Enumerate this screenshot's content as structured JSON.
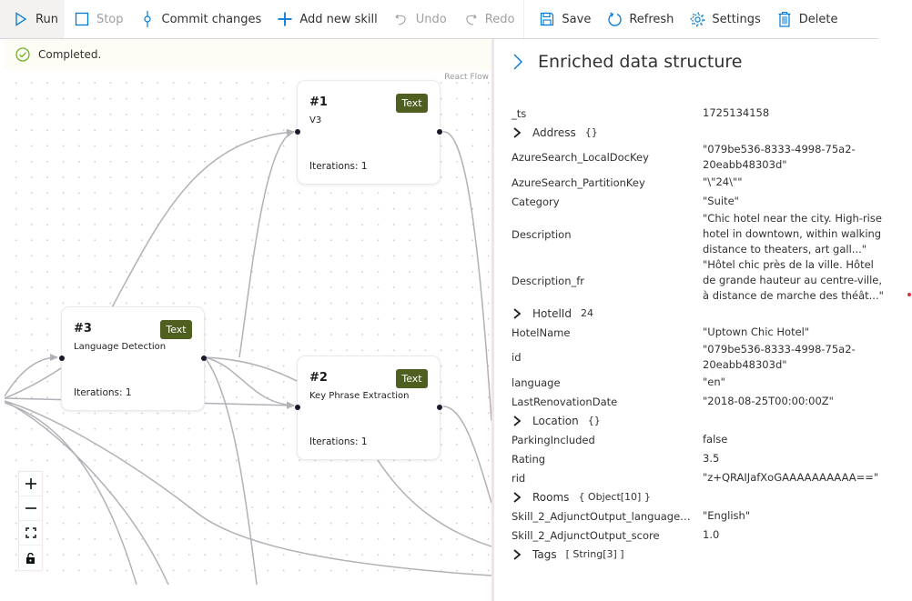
{
  "toolbar": {
    "run": "Run",
    "stop": "Stop",
    "commit": "Commit changes",
    "add_skill": "Add new skill",
    "undo": "Undo",
    "redo": "Redo",
    "save": "Save",
    "refresh": "Refresh",
    "settings": "Settings",
    "delete": "Delete"
  },
  "status": {
    "text": "Completed."
  },
  "canvas": {
    "attribution": "React Flow",
    "nodes": [
      {
        "num": "#1",
        "name": "V3",
        "tag": "Text",
        "iterations": "Iterations: 1"
      },
      {
        "num": "#3",
        "name": "Language Detection",
        "tag": "Text",
        "iterations": "Iterations: 1"
      },
      {
        "num": "#2",
        "name": "Key Phrase Extraction",
        "tag": "Text",
        "iterations": "Iterations: 1"
      }
    ],
    "controls": [
      "zoom-in",
      "zoom-out",
      "fit-view",
      "lock"
    ]
  },
  "panel": {
    "title": "Enriched data structure",
    "rows": [
      {
        "key": "_ts",
        "value": "1725134158"
      },
      {
        "key": "Address",
        "type": "{}",
        "expandable": true
      },
      {
        "key": "AzureSearch_LocalDocKey",
        "value": "\"079be536-8333-4998-75a2-20eabb48303d\""
      },
      {
        "key": "AzureSearch_PartitionKey",
        "value": "\"\\\"24\\\"\""
      },
      {
        "key": "Category",
        "value": "\"Suite\""
      },
      {
        "key": "Description",
        "value": "\"Chic hotel near the city. High-rise hotel in downtown, within walking distance to theaters, art gall...\""
      },
      {
        "key": "Description_fr",
        "value": "\"Hôtel chic près de la ville. Hôtel de grande hauteur au centre-ville, à distance de marche des théât...\""
      },
      {
        "key": "HotelId",
        "type": "24",
        "expandable": true
      },
      {
        "key": "HotelName",
        "value": "\"Uptown Chic Hotel\""
      },
      {
        "key": "id",
        "value": "\"079be536-8333-4998-75a2-20eabb48303d\""
      },
      {
        "key": "language",
        "value": "\"en\""
      },
      {
        "key": "LastRenovationDate",
        "value": "\"2018-08-25T00:00:00Z\""
      },
      {
        "key": "Location",
        "type": "{}",
        "expandable": true
      },
      {
        "key": "ParkingIncluded",
        "value": "false"
      },
      {
        "key": "Rating",
        "value": "3.5"
      },
      {
        "key": "rid",
        "value": "\"z+QRAIJafXoGAAAAAAAAAA==\""
      },
      {
        "key": "Rooms",
        "type": "{ Object[10] }",
        "expandable": true
      },
      {
        "key": "Skill_2_AdjunctOutput_languageN...",
        "value": "\"English\""
      },
      {
        "key": "Skill_2_AdjunctOutput_score",
        "value": "1.0"
      },
      {
        "key": "Tags",
        "type": "[ String[3] ]",
        "expandable": true
      }
    ]
  }
}
